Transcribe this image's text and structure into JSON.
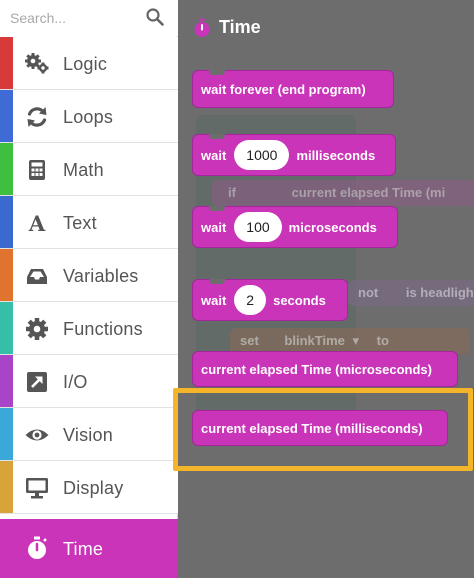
{
  "search": {
    "placeholder": "Search..."
  },
  "categories": [
    {
      "label": "Logic",
      "color": "#d83a3a",
      "icon": "gears-icon"
    },
    {
      "label": "Loops",
      "color": "#3f6bd6",
      "icon": "loop-icon"
    },
    {
      "label": "Math",
      "color": "#3fbf3f",
      "icon": "calculator-icon"
    },
    {
      "label": "Text",
      "color": "#3a6ad0",
      "icon": "text-icon"
    },
    {
      "label": "Variables",
      "color": "#e0742f",
      "icon": "inbox-icon"
    },
    {
      "label": "Functions",
      "color": "#35bfa6",
      "icon": "gear-icon"
    },
    {
      "label": "I/O",
      "color": "#a944c9",
      "icon": "arrow-icon"
    },
    {
      "label": "Vision",
      "color": "#3aa8d8",
      "icon": "eye-icon"
    },
    {
      "label": "Display",
      "color": "#d8a43a",
      "icon": "monitor-icon"
    },
    {
      "label": "Time",
      "color": "#c934b8",
      "icon": "stopwatch-icon"
    }
  ],
  "flyout": {
    "title": "Time",
    "blocks": {
      "wait_forever": "wait forever (end program)",
      "wait_ms": {
        "prefix": "wait",
        "value": "1000",
        "suffix": "milliseconds"
      },
      "wait_us": {
        "prefix": "wait",
        "value": "100",
        "suffix": "microseconds"
      },
      "wait_s": {
        "prefix": "wait",
        "value": "2",
        "suffix": "seconds"
      },
      "elapsed_us": "current elapsed Time (microseconds)",
      "elapsed_ms": "current elapsed Time (milliseconds)"
    }
  },
  "workspace": {
    "if_label": "if",
    "if_block_text": "current elapsed Time (mi",
    "not_label": "not",
    "headlight_text": "is headligh",
    "set_label": "set",
    "var_name": "blinkTime",
    "to_label": "to"
  },
  "colors": {
    "accent": "#c934b8",
    "highlight": "#f4b52a",
    "flyout_bg": "#6d6d6d"
  }
}
